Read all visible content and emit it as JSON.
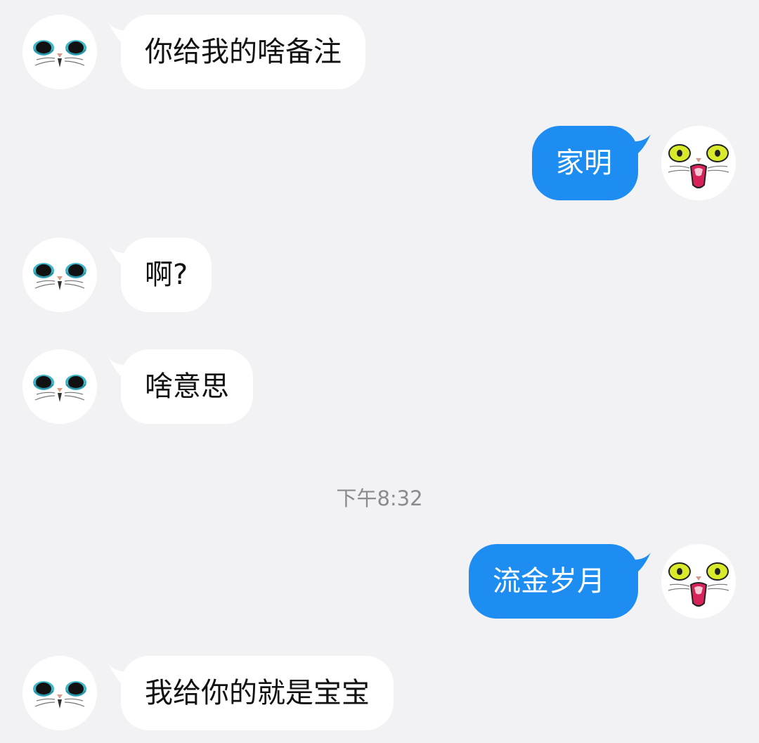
{
  "colors": {
    "background": "#f2f2f4",
    "incoming_bubble": "#ffffff",
    "outgoing_bubble": "#1e8df2",
    "timestamp_text": "#8a8a8f"
  },
  "contact": {
    "avatar_icon": "blue-eyed-cat-icon"
  },
  "me": {
    "avatar_icon": "yellow-eyed-screaming-cat-icon"
  },
  "messages": [
    {
      "direction": "incoming",
      "text": "你给我的啥备注"
    },
    {
      "direction": "outgoing",
      "text": "家明"
    },
    {
      "direction": "incoming",
      "text": "啊?"
    },
    {
      "direction": "incoming",
      "text": "啥意思"
    },
    {
      "direction": "outgoing",
      "text": "流金岁月"
    },
    {
      "direction": "incoming",
      "text": "我给你的就是宝宝"
    }
  ],
  "timestamp": "下午8:32"
}
